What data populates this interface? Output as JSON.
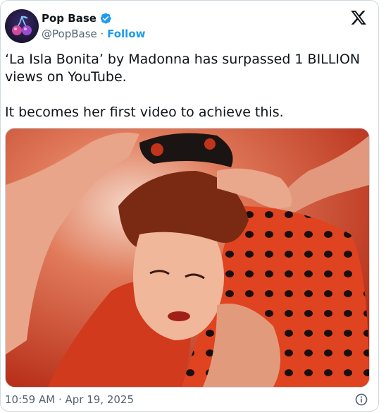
{
  "account": {
    "display_name": "Pop Base",
    "handle": "@PopBase",
    "separator": "·",
    "follow_label": "Follow",
    "verified": true
  },
  "post": {
    "text": "‘La Isla Bonita’ by Madonna has surpassed 1 BILLION views on YouTube.\n\nIt becomes her first video to achieve this.",
    "timestamp": "10:59 AM · Apr 19, 2025"
  },
  "icons": {
    "brand": "x-logo-icon",
    "verified": "verified-badge-icon",
    "info": "info-icon",
    "avatar": "cherries-avatar"
  },
  "colors": {
    "accent": "#1d9bf0",
    "text": "#0f1419",
    "secondary": "#536471",
    "border": "#cfd9de"
  }
}
